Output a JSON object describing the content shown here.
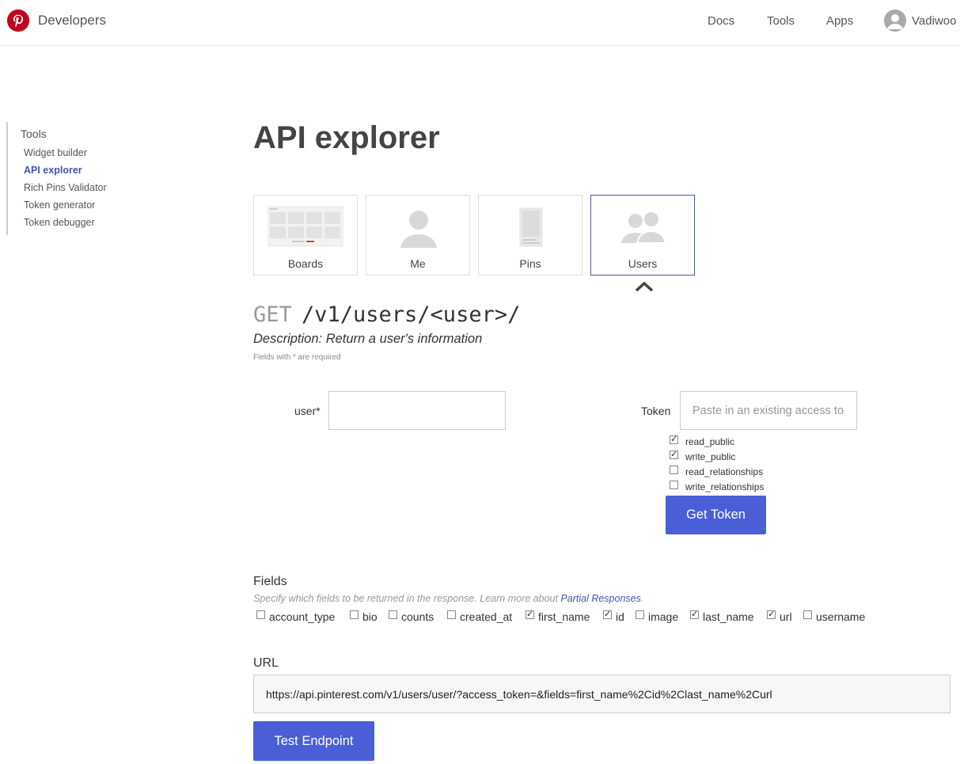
{
  "header": {
    "brand": "Developers",
    "nav": [
      {
        "label": "Docs"
      },
      {
        "label": "Tools"
      },
      {
        "label": "Apps"
      }
    ],
    "user_name": "Vadiwoo",
    "brand_color": "#bd081c"
  },
  "sidebar": {
    "title": "Tools",
    "items": [
      {
        "label": "Widget builder",
        "active": false
      },
      {
        "label": "API explorer",
        "active": true
      },
      {
        "label": "Rich Pins Validator",
        "active": false
      },
      {
        "label": "Token generator",
        "active": false
      },
      {
        "label": "Token debugger",
        "active": false
      }
    ]
  },
  "main": {
    "title": "API explorer",
    "categories": [
      {
        "label": "Boards",
        "icon": "boards-icon",
        "selected": false
      },
      {
        "label": "Me",
        "icon": "person-icon",
        "selected": false
      },
      {
        "label": "Pins",
        "icon": "pin-icon",
        "selected": false
      },
      {
        "label": "Users",
        "icon": "users-icon",
        "selected": true
      }
    ],
    "endpoint": {
      "method": "GET",
      "path": "/v1/users/<user>/",
      "description": "Description: Return a user's information",
      "required_note": "Fields with * are required"
    },
    "user_field": {
      "label": "user*",
      "value": ""
    },
    "token_field": {
      "label": "Token",
      "placeholder": "Paste in an existing access token"
    },
    "scopes": [
      {
        "label": "read_public",
        "checked": true
      },
      {
        "label": "write_public",
        "checked": true
      },
      {
        "label": "read_relationships",
        "checked": false
      },
      {
        "label": "write_relationships",
        "checked": false
      }
    ],
    "get_token_label": "Get Token",
    "fields": {
      "title": "Fields",
      "help_text": "Specify which fields to be returned in the response. Learn more about ",
      "help_link": "Partial Responses",
      "help_suffix": ".",
      "options": [
        {
          "label": "account_type",
          "checked": false
        },
        {
          "label": "bio",
          "checked": false
        },
        {
          "label": "counts",
          "checked": false
        },
        {
          "label": "created_at",
          "checked": false
        },
        {
          "label": "first_name",
          "checked": true
        },
        {
          "label": "id",
          "checked": true
        },
        {
          "label": "image",
          "checked": false
        },
        {
          "label": "last_name",
          "checked": true
        },
        {
          "label": "url",
          "checked": true
        },
        {
          "label": "username",
          "checked": false
        }
      ]
    },
    "url": {
      "title": "URL",
      "value": "https://api.pinterest.com/v1/users/user/?access_token=&fields=first_name%2Cid%2Clast_name%2Curl"
    },
    "test_button_label": "Test Endpoint",
    "accent_color": "#4a5fd6",
    "link_color": "#4357a6"
  }
}
